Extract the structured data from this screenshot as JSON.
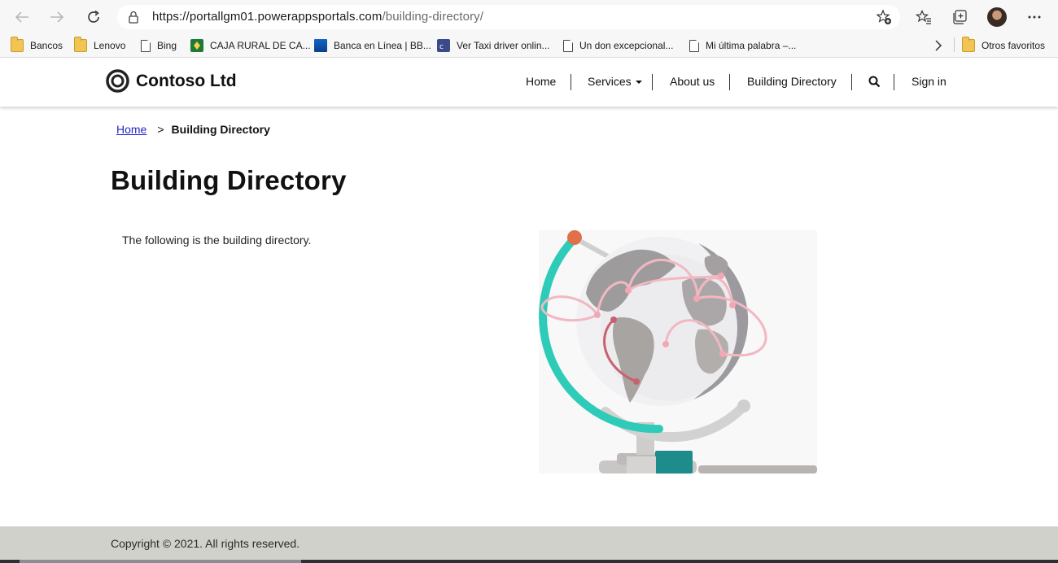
{
  "browser": {
    "url_host": "https://portallgm01.powerappsportals.com",
    "url_path": "/building-directory/",
    "icons": [
      "back-icon",
      "forward-icon",
      "refresh-icon",
      "lock-icon",
      "add-favorite-icon",
      "favorites-icon",
      "collections-icon",
      "profile-avatar",
      "more-icon"
    ]
  },
  "bookmarks": {
    "items": [
      {
        "label": "Bancos",
        "icon": "folder-icon"
      },
      {
        "label": "Lenovo",
        "icon": "folder-icon"
      },
      {
        "label": "Bing",
        "icon": "page-icon"
      },
      {
        "label": "CAJA RURAL DE CA...",
        "icon": "caja-rural-icon"
      },
      {
        "label": "Banca en Línea | BB...",
        "icon": "bbva-icon"
      },
      {
        "label": "Ver Taxi driver onlin...",
        "icon": "video-site-icon"
      },
      {
        "label": "Un don excepcional...",
        "icon": "page-icon"
      },
      {
        "label": "Mi última palabra –...",
        "icon": "page-icon"
      }
    ],
    "other_favorites": "Otros favoritos"
  },
  "site": {
    "brand": "Contoso Ltd",
    "nav": {
      "home": "Home",
      "services": "Services",
      "about": "About us",
      "directory": "Building Directory",
      "signin": "Sign in"
    }
  },
  "breadcrumb": {
    "home": "Home",
    "separator": ">",
    "current": "Building Directory"
  },
  "main": {
    "title": "Building Directory",
    "intro": "The following is the building directory."
  },
  "footer": {
    "copyright": "Copyright © 2021. All rights reserved."
  },
  "colors": {
    "link": "#2626c8",
    "footer_bg": "#d1d1cc",
    "globe_teal": "#2ecbb8",
    "globe_pin": "#e07047",
    "route_pink": "#f2b8c2"
  }
}
